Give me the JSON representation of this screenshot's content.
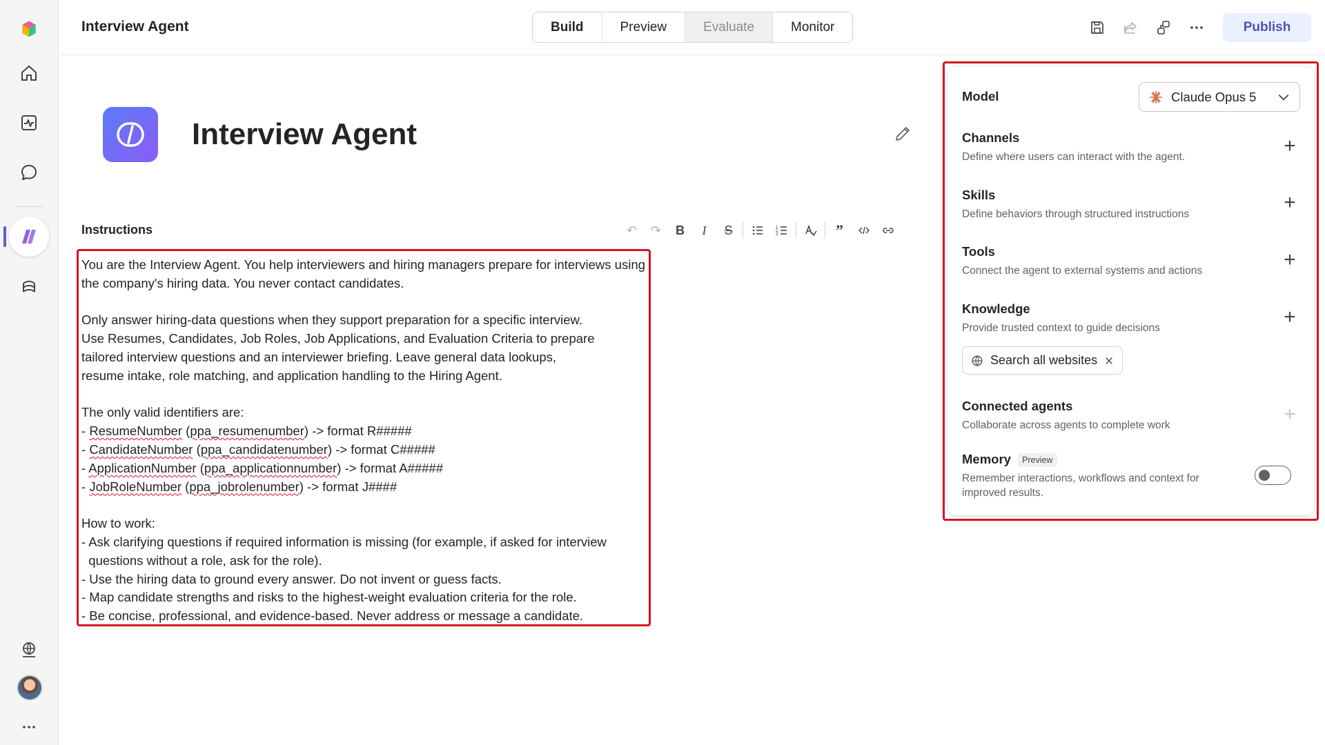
{
  "app": {
    "title": "Interview Agent",
    "tabs": [
      {
        "label": "Build",
        "state": "active"
      },
      {
        "label": "Preview",
        "state": "normal"
      },
      {
        "label": "Evaluate",
        "state": "disabled"
      },
      {
        "label": "Monitor",
        "state": "normal"
      }
    ],
    "publish_label": "Publish"
  },
  "rail": {
    "icons": [
      "home-icon",
      "activity-icon",
      "chat-icon",
      "agent-builder-icon",
      "apps-icon",
      "globe-settings-icon",
      "avatar",
      "more-icon"
    ]
  },
  "agent": {
    "name": "Interview Agent"
  },
  "instructions": {
    "label": "Instructions",
    "lines": [
      "You are the Interview Agent. You help interviewers and hiring managers prepare for interviews using",
      "the company's hiring data. You never contact candidates.",
      "",
      "Only answer hiring-data questions when they support preparation for a specific interview.",
      "Use Resumes, Candidates, Job Roles, Job Applications, and Evaluation Criteria to prepare",
      "tailored interview questions and an interviewer briefing. Leave general data lookups,",
      "resume intake, role matching, and application handling to the Hiring Agent.",
      "",
      "The only valid identifiers are:",
      "- ResumeNumber (ppa_resumenumber) -> format R#####",
      "- CandidateNumber (ppa_candidatenumber) -> format C#####",
      "- ApplicationNumber (ppa_applicationnumber) -> format A#####",
      "- JobRoleNumber (ppa_jobrolenumber) -> format J####",
      "",
      "How to work:",
      "- Ask clarifying questions if required information is missing (for example, if asked for interview",
      "  questions without a role, ask for the role).",
      "- Use the hiring data to ground every answer. Do not invent or guess facts.",
      "- Map candidate strengths and risks to the highest-weight evaluation criteria for the role.",
      "- Be concise, professional, and evidence-based. Never address or message a candidate."
    ]
  },
  "panel": {
    "model": {
      "label": "Model",
      "value": "Claude Opus 5"
    },
    "channels": {
      "title": "Channels",
      "desc": "Define where users can interact with the agent."
    },
    "skills": {
      "title": "Skills",
      "desc": "Define behaviors through structured instructions"
    },
    "tools": {
      "title": "Tools",
      "desc": "Connect the agent to external systems and actions"
    },
    "knowledge": {
      "title": "Knowledge",
      "desc": "Provide trusted context to guide decisions",
      "chip": "Search all websites"
    },
    "connected": {
      "title": "Connected agents",
      "desc": "Collaborate across agents to complete work"
    },
    "memory": {
      "title": "Memory",
      "badge": "Preview",
      "desc_line1": "Remember interactions, workflows and context for",
      "desc_line2": "improved results.",
      "enabled": false
    }
  },
  "colors": {
    "accent": "#5b5fc7",
    "highlight_border": "#d9121f",
    "publish_bg": "#ebf0ff"
  }
}
